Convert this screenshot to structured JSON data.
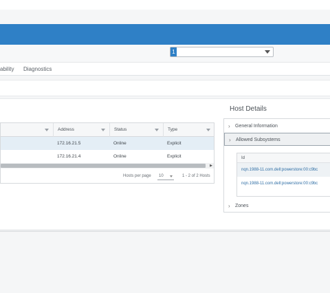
{
  "header": {
    "brand_color": "#2f80c6"
  },
  "selector": {
    "badge": "1",
    "value": ""
  },
  "tabs": [
    {
      "label": "ability"
    },
    {
      "label": "Diagnostics"
    }
  ],
  "hosts_grid": {
    "columns": [
      "Address",
      "Status",
      "Type"
    ],
    "rows": [
      {
        "address": "172.16.21.5",
        "status": "Online",
        "type": "Explicit",
        "selected": true
      },
      {
        "address": "172.16.21.4",
        "status": "Online",
        "type": "Explicit",
        "selected": false
      }
    ],
    "footer": {
      "per_page_label": "Hosts per page",
      "per_page_value": "10",
      "range": "1 - 2 of 2 Hosts"
    }
  },
  "host_details": {
    "title": "Host Details",
    "sections": {
      "general": "General Information",
      "allowed": "Allowed Subsystems",
      "zones": "Zones"
    },
    "subsystems": {
      "header": "Id",
      "rows": [
        "nqn.1988-11.com.dell:powerstore:00:c9bc",
        "nqn.1988-11.com.dell:powerstore:00:c9bc"
      ]
    }
  }
}
